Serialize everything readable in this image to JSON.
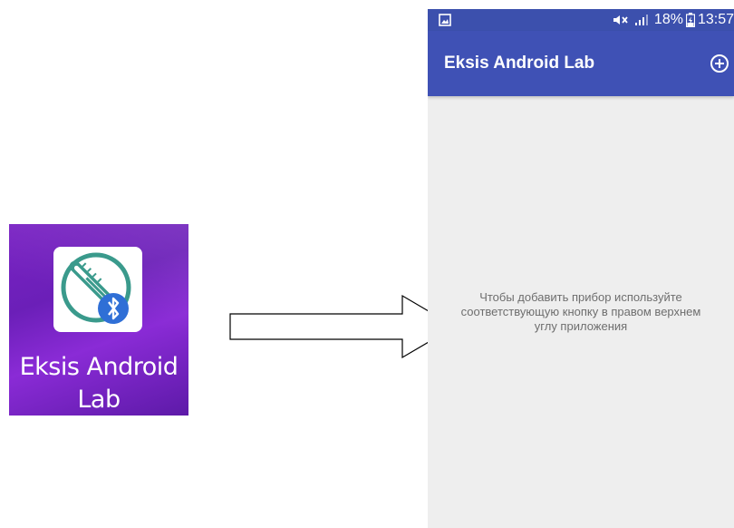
{
  "launcher": {
    "icon_name": "thermometer-bluetooth-icon",
    "label_line1": "Eksis Android",
    "label_line2": "Lab",
    "colors": {
      "background": "#7a23c4",
      "icon_teal": "#3a9a8c",
      "bluetooth_blue": "#2f6fd6"
    }
  },
  "arrow": {
    "icon_name": "right-arrow-icon"
  },
  "phone": {
    "statusbar": {
      "image_icon": "image-notification-icon",
      "mute_icon": "muted-volume-icon",
      "signal_icon": "signal-bars-icon",
      "battery_text": "18%",
      "battery_icon": "battery-charging-icon",
      "time": "13:57",
      "color": "#3c50ad"
    },
    "appbar": {
      "title": "Eksis Android Lab",
      "add_icon": "add-circle-icon",
      "color": "#3f51b5"
    },
    "empty_state": {
      "line1": "Чтобы добавить прибор используйте",
      "line2": "соответствующую кнопку в правом верхнем",
      "line3": "углу приложения"
    }
  }
}
